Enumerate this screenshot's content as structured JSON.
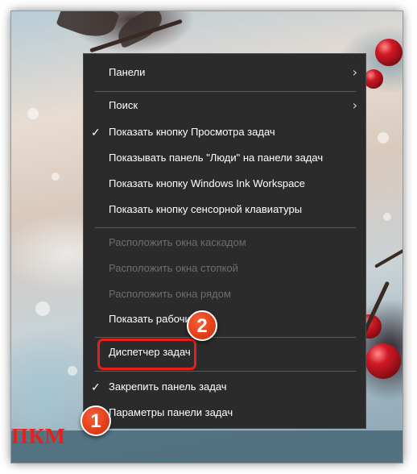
{
  "menu": {
    "items": [
      {
        "label": "Панели",
        "checked": false,
        "submenu": true,
        "enabled": true
      },
      {
        "label": "Поиск",
        "checked": false,
        "submenu": true,
        "enabled": true
      },
      {
        "label": "Показать кнопку Просмотра задач",
        "checked": true,
        "submenu": false,
        "enabled": true
      },
      {
        "label": "Показывать панель \"Люди\" на панели задач",
        "checked": false,
        "submenu": false,
        "enabled": true
      },
      {
        "label": "Показать кнопку Windows Ink Workspace",
        "checked": false,
        "submenu": false,
        "enabled": true
      },
      {
        "label": "Показать кнопку сенсорной клавиатуры",
        "checked": false,
        "submenu": false,
        "enabled": true
      },
      {
        "label": "Расположить окна каскадом",
        "checked": false,
        "submenu": false,
        "enabled": false
      },
      {
        "label": "Расположить окна стопкой",
        "checked": false,
        "submenu": false,
        "enabled": false
      },
      {
        "label": "Расположить окна рядом",
        "checked": false,
        "submenu": false,
        "enabled": false
      },
      {
        "label": "Показать рабочий",
        "checked": false,
        "submenu": false,
        "enabled": true
      },
      {
        "label": "Диспетчер задач",
        "checked": false,
        "submenu": false,
        "enabled": true
      },
      {
        "label": "Закрепить панель задач",
        "checked": true,
        "submenu": false,
        "enabled": true
      },
      {
        "label": "Параметры панели задач",
        "checked": false,
        "submenu": false,
        "enabled": true
      }
    ],
    "check_glyph": "✓",
    "chevron_glyph": "›"
  },
  "annotations": {
    "badge_1": "1",
    "badge_2": "2",
    "caption": "ПКМ",
    "accent_color": "#e8201c",
    "badge_color": "#e5401c"
  },
  "colors": {
    "menu_bg": "#2b2b2b",
    "menu_text": "#ffffff",
    "menu_disabled_text": "#6d6d6d",
    "taskbar": "#4e6d7d"
  }
}
